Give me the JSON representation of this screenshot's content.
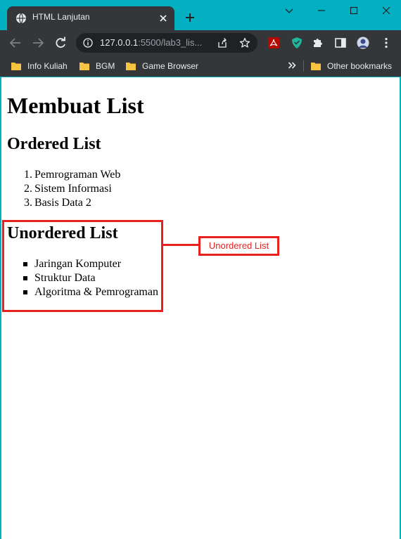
{
  "colors": {
    "frame_accent": "#02b0c2",
    "chrome_dark": "#35363a",
    "omnibox_bg": "#202124",
    "chrome_text": "#e8eaed",
    "annotation_red": "#e8201e"
  },
  "tab": {
    "title": "HTML Lanjutan",
    "favicon": "globe-icon"
  },
  "address_bar": {
    "host": "127.0.0.1",
    "rest": ":5500/lab3_lis..."
  },
  "bookmarks": [
    {
      "label": "Info Kuliah",
      "icon": "folder-icon"
    },
    {
      "label": "BGM",
      "icon": "folder-icon"
    },
    {
      "label": "Game Browser",
      "icon": "folder-icon"
    }
  ],
  "other_bookmarks": "Other bookmarks",
  "page": {
    "title": "Membuat List",
    "ordered_heading": "Ordered List",
    "ordered_items": [
      {
        "num": "1.",
        "text": "Pemrograman Web"
      },
      {
        "num": "2.",
        "text": "Sistem Informasi"
      },
      {
        "num": "3.",
        "text": "Basis Data 2"
      }
    ],
    "unordered_heading": "Unordered List",
    "unordered_items": [
      {
        "text": "Jaringan Komputer"
      },
      {
        "text": "Struktur Data"
      },
      {
        "text": "Algoritma & Pemrograman"
      }
    ]
  },
  "annotation": {
    "label": "Unordered List"
  }
}
